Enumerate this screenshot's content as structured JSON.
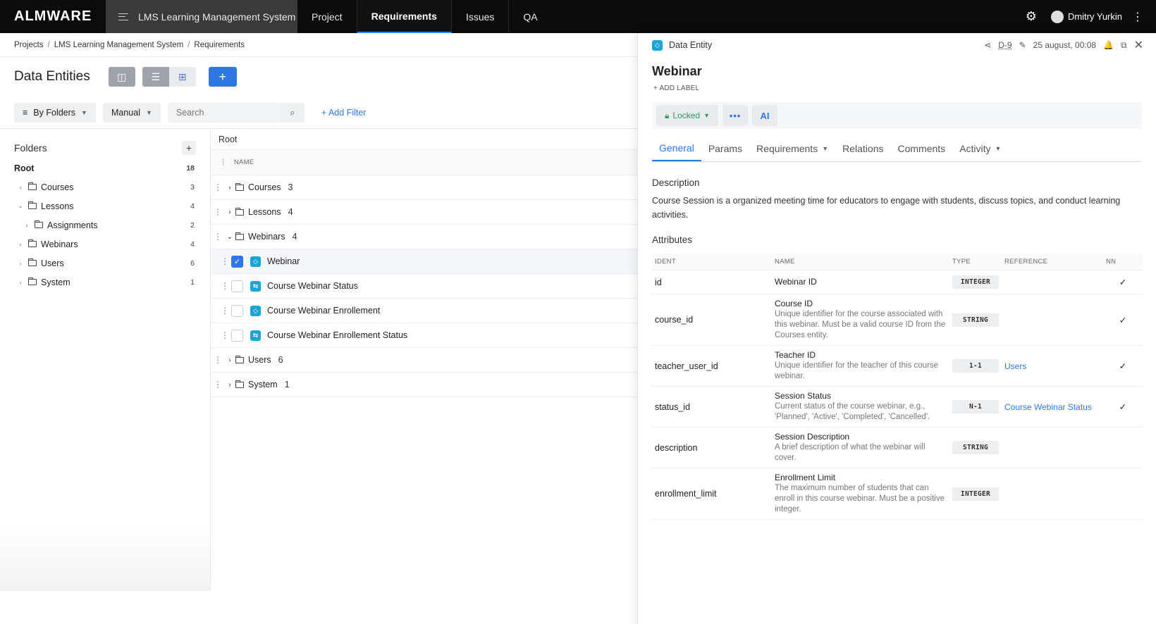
{
  "app": {
    "logo": "ALMWARE",
    "project": "LMS Learning Management System",
    "nav": [
      "Project",
      "Requirements",
      "Issues",
      "QA"
    ],
    "active_nav": "Requirements",
    "user": "Dmitry Yurkin"
  },
  "breadcrumb": [
    "Projects",
    "LMS Learning Management System",
    "Requirements"
  ],
  "page": {
    "title": "Data Entities",
    "filters": {
      "group_by": "By Folders",
      "sort": "Manual",
      "search_placeholder": "Search",
      "add_filter": "+ Add Filter"
    }
  },
  "folders": {
    "title": "Folders",
    "items": [
      {
        "label": "Root",
        "count": "18",
        "level": 0,
        "arrow": ""
      },
      {
        "label": "Courses",
        "count": "3",
        "level": 1,
        "arrow": "›"
      },
      {
        "label": "Lessons",
        "count": "4",
        "level": 1,
        "arrow": "⌄"
      },
      {
        "label": "Assignments",
        "count": "2",
        "level": 2,
        "arrow": "›"
      },
      {
        "label": "Webinars",
        "count": "4",
        "level": 1,
        "arrow": "›"
      },
      {
        "label": "Users",
        "count": "6",
        "level": 1,
        "arrow": "›"
      },
      {
        "label": "System",
        "count": "1",
        "level": 1,
        "arrow": "›"
      }
    ]
  },
  "tree": {
    "root_label": "Root",
    "column_name": "NAME",
    "rows": [
      {
        "type": "folder",
        "label": "Courses",
        "count": "3",
        "arrow": "›"
      },
      {
        "type": "folder",
        "label": "Lessons",
        "count": "4",
        "arrow": "›"
      },
      {
        "type": "folder",
        "label": "Webinars",
        "count": "4",
        "arrow": "⌄"
      },
      {
        "type": "entity",
        "label": "Webinar",
        "checked": true
      },
      {
        "type": "entity",
        "label": "Course Webinar Status",
        "checked": false
      },
      {
        "type": "entity",
        "label": "Course Webinar Enrollement",
        "checked": false
      },
      {
        "type": "entity",
        "label": "Course Webinar Enrollement Status",
        "checked": false
      },
      {
        "type": "folder",
        "label": "Users",
        "count": "6",
        "arrow": "›"
      },
      {
        "type": "folder",
        "label": "System",
        "count": "1",
        "arrow": "›"
      }
    ]
  },
  "panel": {
    "kind": "Data Entity",
    "id": "D-9",
    "date": "25 august, 00:08",
    "title": "Webinar",
    "add_label": "+ ADD LABEL",
    "lock": "Locked",
    "ai": "AI",
    "tabs": [
      "General",
      "Params",
      "Requirements",
      "Relations",
      "Comments",
      "Activity"
    ],
    "description_title": "Description",
    "description": "Course Session is a organized meeting time for educators to engage with students, discuss topics, and conduct learning activities.",
    "attributes_title": "Attributes",
    "columns": [
      "IDENT",
      "NAME",
      "TYPE",
      "REFERENCE",
      "NN"
    ],
    "attributes": [
      {
        "ident": "id",
        "name": "Webinar ID",
        "desc": "",
        "type": "INTEGER",
        "ref": "",
        "nn": true
      },
      {
        "ident": "course_id",
        "name": "Course ID",
        "desc": "Unique identifier for the course associated with this webinar. Must be a valid course ID from the Courses entity.",
        "type": "STRING",
        "ref": "",
        "nn": true
      },
      {
        "ident": "teacher_user_id",
        "name": "Teacher ID",
        "desc": "Unique identifier for the teacher of this course webinar.",
        "type": "1-1",
        "ref": "Users",
        "nn": true
      },
      {
        "ident": "status_id",
        "name": "Session Status",
        "desc": "Current status of the course webinar, e.g., 'Planned', 'Active', 'Completed', 'Cancelled'.",
        "type": "N-1",
        "ref": "Course Webinar Status",
        "nn": true
      },
      {
        "ident": "description",
        "name": "Session Description",
        "desc": "A brief description of what the webinar will cover.",
        "type": "STRING",
        "ref": "",
        "nn": false
      },
      {
        "ident": "enrollment_limit",
        "name": "Enrollment Limit",
        "desc": "The maximum number of students that can enroll in this course webinar. Must be a positive integer.",
        "type": "INTEGER",
        "ref": "",
        "nn": false
      }
    ]
  }
}
